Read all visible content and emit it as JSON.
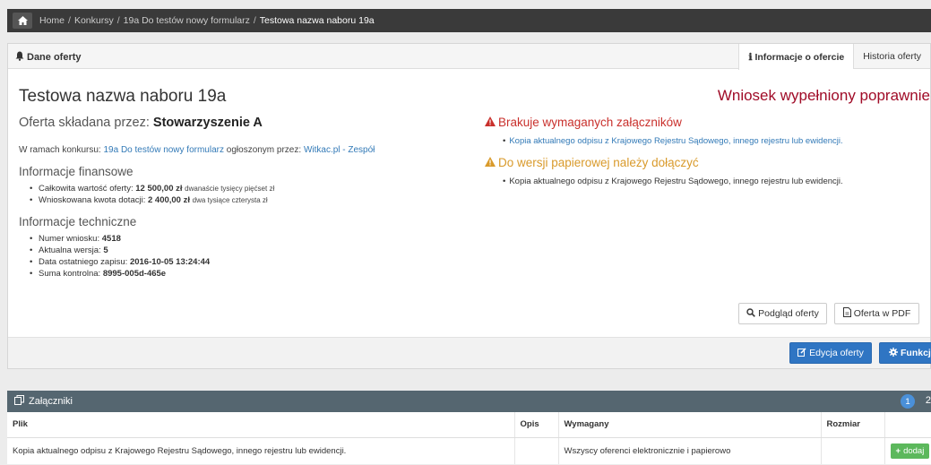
{
  "breadcrumb": {
    "items": [
      "Home",
      "Konkursy",
      "19a Do testów nowy formularz"
    ],
    "current": "Testowa nazwa naboru 19a"
  },
  "panel": {
    "title": "Dane oferty",
    "tabs": [
      {
        "label": "Informacje o ofercie",
        "active": true
      },
      {
        "label": "Historia oferty",
        "active": false
      }
    ]
  },
  "offer": {
    "title": "Testowa nazwa naboru 19a",
    "status": "Wniosek wypełniony poprawnie",
    "submitted_prefix": "Oferta składana przez:",
    "submitted_by": "Stowarzyszenie A",
    "context_prefix": "W ramach konkursu:",
    "contest_link": "19a Do testów nowy formularz",
    "context_middle": "ogłoszonym przez:",
    "announcer_link": "Witkac.pl - Zespół"
  },
  "financial": {
    "heading": "Informacje finansowe",
    "items": [
      {
        "label": "Całkowita wartość oferty:",
        "value": "12 500,00 zł",
        "words": "dwanaście tysięcy pięćset zł"
      },
      {
        "label": "Wnioskowana kwota dotacji:",
        "value": "2 400,00 zł",
        "words": "dwa tysiące czterysta zł"
      }
    ]
  },
  "technical": {
    "heading": "Informacje techniczne",
    "items": [
      {
        "label": "Numer wniosku:",
        "value": "4518"
      },
      {
        "label": "Aktualna wersja:",
        "value": "5"
      },
      {
        "label": "Data ostatniego zapisu:",
        "value": "2016-10-05 13:24:44"
      },
      {
        "label": "Suma kontrolna:",
        "value": "8995-005d-465e"
      }
    ]
  },
  "warnings": {
    "missing_heading": "Brakuje wymaganych załączników",
    "missing_item": "Kopia aktualnego odpisu z Krajowego Rejestru Sądowego, innego rejestru lub ewidencji.",
    "paper_heading": "Do wersji papierowej należy dołączyć",
    "paper_item": "Kopia aktualnego odpisu z Krajowego Rejestru Sądowego, innego rejestru lub ewidencji."
  },
  "buttons": {
    "preview": "Podgląd oferty",
    "pdf": "Oferta w PDF",
    "edit": "Edycja oferty",
    "functions": "Funkcje"
  },
  "attachments": {
    "title": "Załączniki",
    "count": "1",
    "extra": "2",
    "columns": [
      "Plik",
      "Opis",
      "Wymagany",
      "Rozmiar",
      ""
    ],
    "rows": [
      {
        "file": "Kopia aktualnego odpisu z Krajowego Rejestru Sądowego, innego rejestru lub ewidencji.",
        "desc": "",
        "required": "Wszyscy oferenci elektronicznie i papierowo",
        "size": "",
        "action": "dodaj"
      }
    ]
  },
  "colors": {
    "status_red": "#a00b27",
    "warning_red": "#c9302c",
    "warning_orange": "#d99a2b",
    "primary": "#2f75c3",
    "success": "#5cb85c",
    "dark_bar": "#3a3a3a",
    "attachments_bar": "#556670"
  }
}
